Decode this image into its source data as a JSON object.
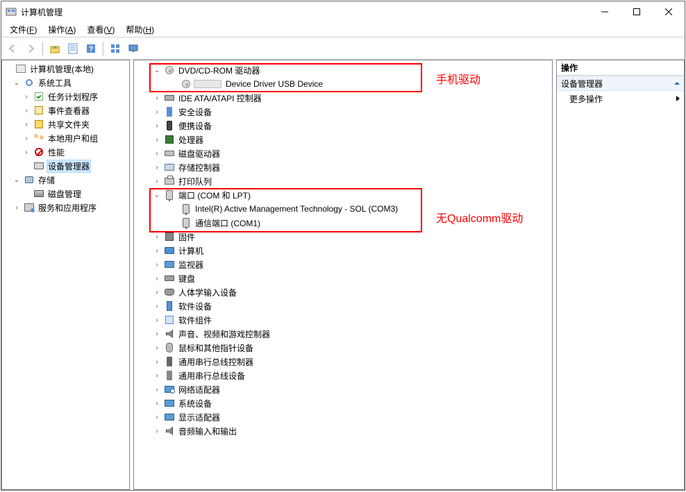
{
  "window": {
    "title": "计算机管理"
  },
  "menu": {
    "file": {
      "label": "文件",
      "key": "F"
    },
    "action": {
      "label": "操作",
      "key": "A"
    },
    "view": {
      "label": "查看",
      "key": "V"
    },
    "help": {
      "label": "帮助",
      "key": "H"
    }
  },
  "left_tree": {
    "root": "计算机管理(本地)",
    "system_tools": "系统工具",
    "task_scheduler": "任务计划程序",
    "event_viewer": "事件查看器",
    "shared_folders": "共享文件夹",
    "local_users": "本地用户和组",
    "performance": "性能",
    "device_manager": "设备管理器",
    "storage": "存储",
    "disk_mgmt": "磁盘管理",
    "services_apps": "服务和应用程序"
  },
  "center_tree": {
    "dvd_cd": "DVD/CD-ROM 驱动器",
    "usb_device": "Device Driver USB Device",
    "ide": "IDE ATA/ATAPI 控制器",
    "security": "安全设备",
    "portable": "便携设备",
    "cpu": "处理器",
    "diskdrive": "磁盘驱动器",
    "storagectrl": "存储控制器",
    "printq": "打印队列",
    "ports": "端口 (COM 和 LPT)",
    "port_sol": "Intel(R) Active Management Technology - SOL (COM3)",
    "port_com1": "通信端口 (COM1)",
    "firmware": "固件",
    "computer": "计算机",
    "monitor": "监视器",
    "keyboard": "键盘",
    "hid": "人体学输入设备",
    "sw_device": "软件设备",
    "sw_comp": "软件组件",
    "sound": "声音、视频和游戏控制器",
    "mouse": "鼠标和其他指针设备",
    "usbctrl": "通用串行总线控制器",
    "usbdev": "通用串行总线设备",
    "network": "网络适配器",
    "system": "系统设备",
    "display": "显示适配器",
    "audio": "音频输入和输出"
  },
  "right_panel": {
    "header": "操作",
    "context": "设备管理器",
    "more": "更多操作"
  },
  "annotations": {
    "phone_driver": "手机驱动",
    "no_qualcomm": "无Qualcomm驱动"
  }
}
